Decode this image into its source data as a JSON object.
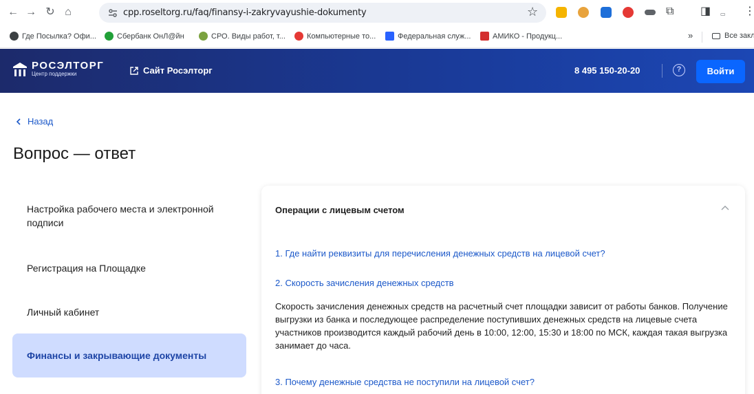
{
  "browser": {
    "url": "cpp.roseltorg.ru/faq/finansy-i-zakryvayushie-dokumenty",
    "bookmarks": [
      {
        "label": "Где Посылка? Офи...",
        "color": "#3c4043"
      },
      {
        "label": "Сбербанк ОнЛ@йн",
        "color": "#21a038"
      },
      {
        "label": "СРО. Виды работ, т...",
        "color": "#7ba23f"
      },
      {
        "label": "Компьютерные то...",
        "color": "#e53935"
      },
      {
        "label": "Федеральная служ...",
        "color": "#2962ff"
      },
      {
        "label": "АМИКО - Продукц...",
        "color": "#d32f2f"
      }
    ],
    "bookmarks_more": "»",
    "all_bookmarks": "Все закладки"
  },
  "header": {
    "logo_name": "РОСЭЛТОРГ",
    "logo_sub": "Центр поддержки",
    "site_link": "Сайт Росэлторг",
    "phone": "8 495 150-20-20",
    "login": "Войти"
  },
  "page": {
    "back": "Назад",
    "title": "Вопрос — ответ"
  },
  "sidebar": {
    "items": [
      {
        "label": "Настройка рабочего места и электронной подписи"
      },
      {
        "label": "Регистрация на Площадке"
      },
      {
        "label": "Личный кабинет"
      },
      {
        "label": "Финансы и закрывающие документы"
      }
    ]
  },
  "section": {
    "title": "Операции с лицевым счетом",
    "questions": [
      "1. Где найти реквизиты для перечисления денежных средств на лицевой счет?",
      "2. Скорость зачисления денежных средств",
      "3. Почему денежные средства не поступили на лицевой счет?"
    ],
    "answer": "Скорость зачисления денежных средств на расчетный счет площадки зависит от работы банков. Получение выгрузки из банка и последующее распределение поступивших денежных средств на лицевые счета участников производится каждый рабочий день в 10:00, 12:00, 15:30 и 18:00 по МСК, каждая такая выгрузка занимает до часа."
  },
  "colors": {
    "accent": "#0a66ff",
    "link": "#1b58c9",
    "active_bg": "#cfdcff"
  }
}
